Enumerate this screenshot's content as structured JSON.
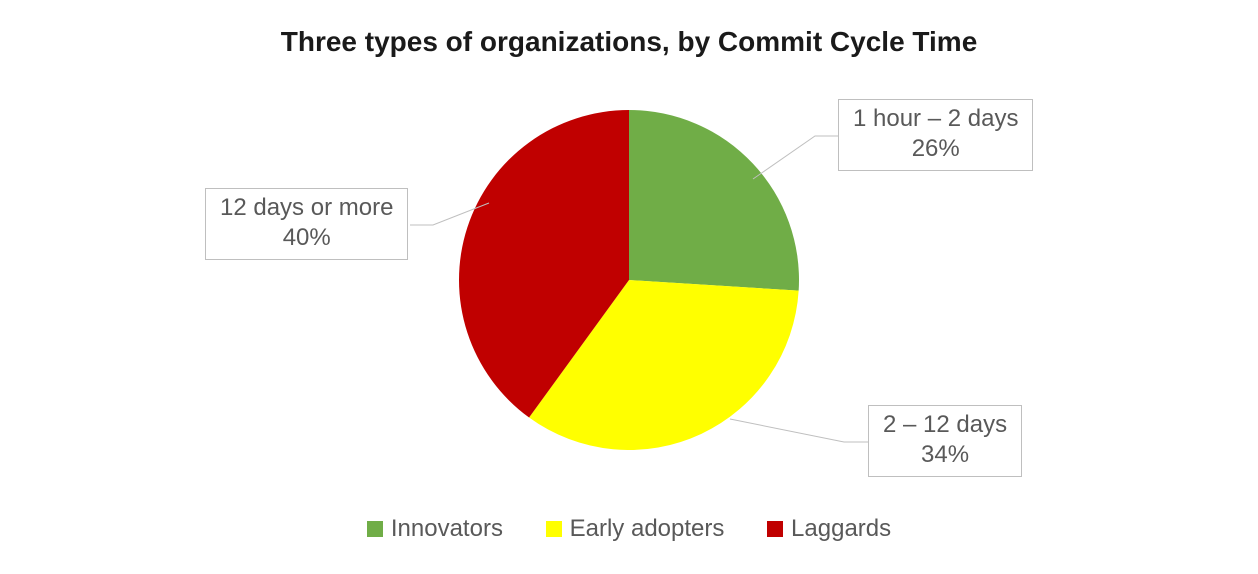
{
  "chart_data": {
    "type": "pie",
    "title": "Three types of organizations, by Commit Cycle Time",
    "series": [
      {
        "name": "Innovators",
        "value": 26,
        "label": "1 hour – 2 days",
        "pct": "26%",
        "color": "#70ad47"
      },
      {
        "name": "Early adopters",
        "value": 34,
        "label": "2 – 12 days",
        "pct": "34%",
        "color": "#ffff00"
      },
      {
        "name": "Laggards",
        "value": 40,
        "label": "12 days or more",
        "pct": "40%",
        "color": "#c00000"
      }
    ],
    "legend_position": "bottom"
  }
}
